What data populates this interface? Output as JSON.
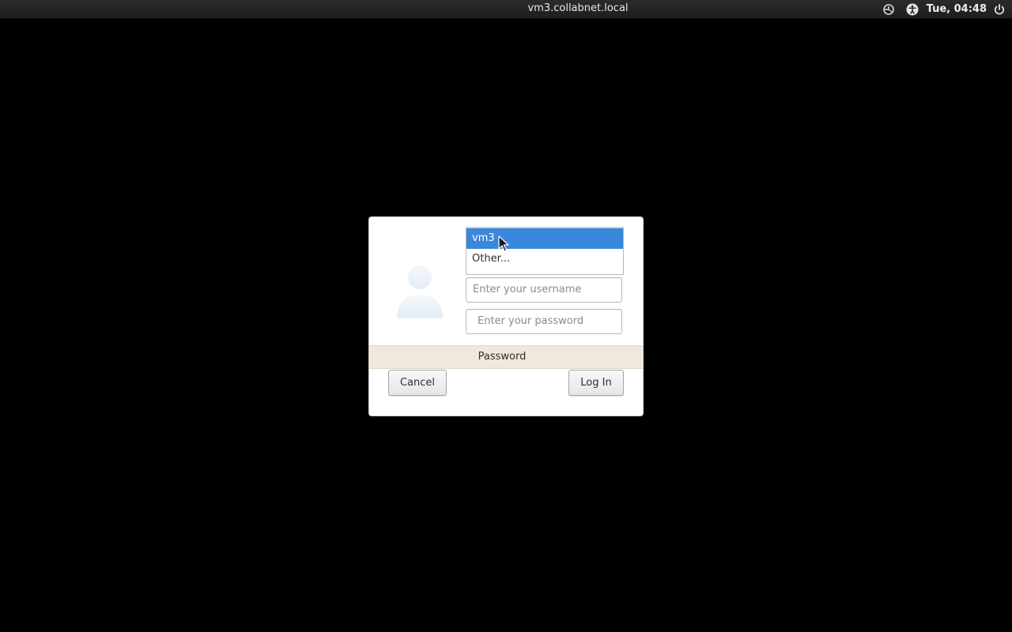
{
  "topbar": {
    "hostname": "vm3.collabnet.local",
    "clock": "Tue, 04:48",
    "icons": [
      "display-settings-icon",
      "accessibility-icon",
      "power-icon"
    ]
  },
  "login": {
    "users": [
      {
        "label": "vm3",
        "selected": true
      },
      {
        "label": "Other...",
        "selected": false
      }
    ],
    "username_placeholder": "Enter your username",
    "password_placeholder": "Enter your password",
    "auth_method": "Password",
    "cancel_label": "Cancel",
    "login_label": "Log In"
  },
  "colors": {
    "selection": "#3b87db",
    "auth_bar": "#f0e8dc",
    "background": "#000000"
  }
}
